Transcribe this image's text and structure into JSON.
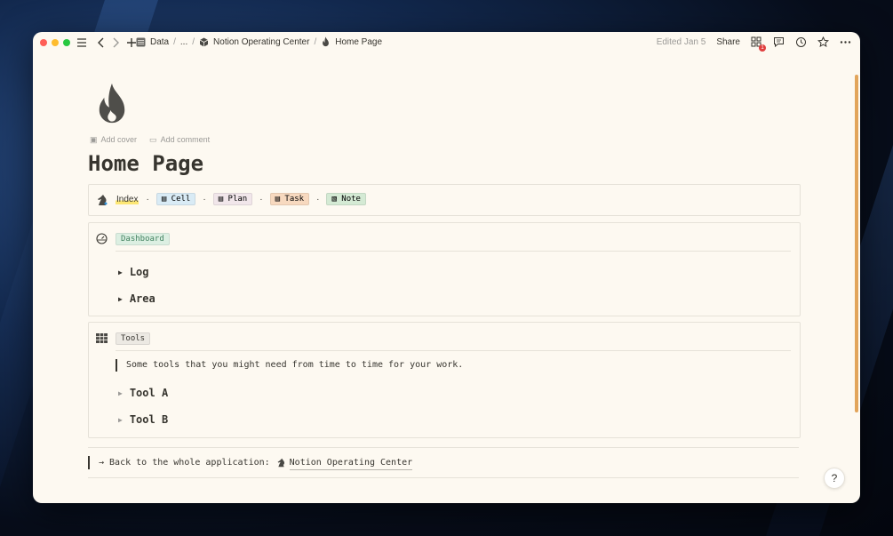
{
  "window": {
    "breadcrumb": [
      {
        "label": "Data",
        "icon": "table-icon"
      },
      {
        "label": "..."
      },
      {
        "label": "Notion Operating Center",
        "icon": "cube-icon"
      },
      {
        "label": "Home Page",
        "icon": "flame-icon"
      }
    ],
    "edited": "Edited Jan 5",
    "share": "Share",
    "notification_count": "1"
  },
  "page": {
    "icon": "flame-icon",
    "add_cover": "Add cover",
    "add_comment": "Add comment",
    "title": "Home Page",
    "nav_links": [
      {
        "label": "Index",
        "bg": "#fff3a8"
      },
      {
        "label": "Cell",
        "bg": "#d9ebf5"
      },
      {
        "label": "Plan",
        "bg": "#f1e6ea"
      },
      {
        "label": "Task",
        "bg": "#f7d9bf"
      },
      {
        "label": "Note",
        "bg": "#d4ead4"
      }
    ],
    "dashboard": {
      "tag": "Dashboard",
      "items": [
        "Log",
        "Area"
      ]
    },
    "tools": {
      "tag": "Tools",
      "description": "Some tools that you might need from time to time for your work.",
      "items": [
        "Tool A",
        "Tool B"
      ]
    },
    "back": {
      "prefix": "→ Back to the whole application:",
      "link": "Notion Operating Center"
    },
    "help": "?"
  },
  "colors": {
    "text": "#37352f",
    "muted": "#9b9a97",
    "page_bg": "#fdf9f1",
    "tag_dashboard": "#dcefe2",
    "tag_tools": "#ece9e3"
  }
}
